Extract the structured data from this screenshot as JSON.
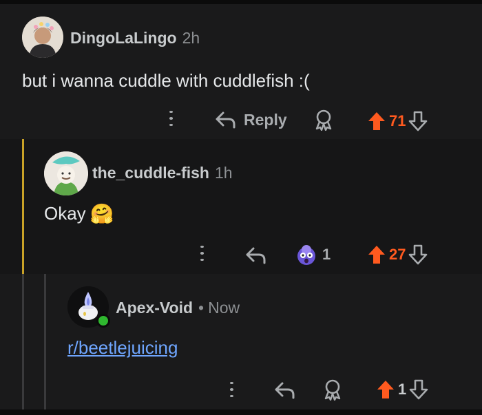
{
  "comments": [
    {
      "author": "DingoLaLingo",
      "time": "2h",
      "body": "but i wanna cuddle with cuddlefish :(",
      "reply_label": "Reply",
      "score": "71"
    },
    {
      "author": "the_cuddle-fish",
      "time": "1h",
      "body": "Okay",
      "emoji": "🤗",
      "award_count": "1",
      "score": "27"
    },
    {
      "author": "Apex-Void",
      "separator": "•",
      "time": "Now",
      "body_link": "r/beetlejuicing",
      "score": "1"
    }
  ],
  "colors": {
    "upvote": "#ff5a1f",
    "link": "#6fa6ff",
    "rail_highlight": "#c9a227",
    "online": "#2fb82f"
  },
  "icons": [
    "more-icon",
    "reply-icon",
    "award-icon",
    "upvote-icon",
    "downvote-icon",
    "online-status-icon"
  ]
}
